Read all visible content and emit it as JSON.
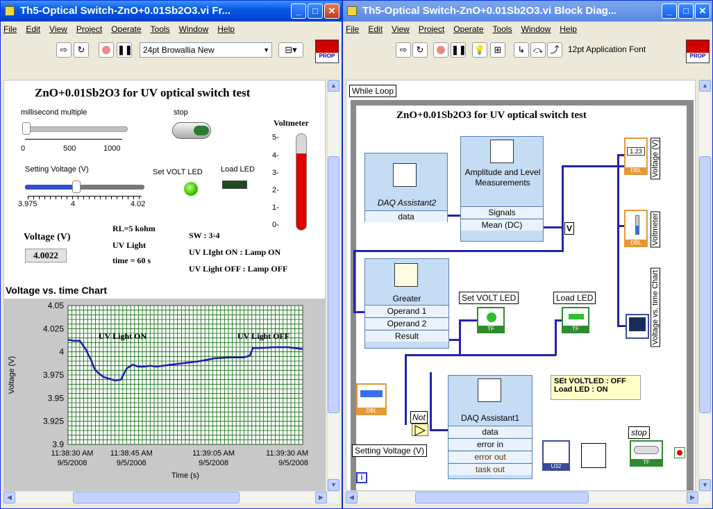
{
  "left_window": {
    "title": "Th5-Optical Switch-ZnO+0.01Sb2O3.vi Fr...",
    "menu": [
      "File",
      "Edit",
      "View",
      "Project",
      "Operate",
      "Tools",
      "Window",
      "Help"
    ],
    "font_selector": "24pt Browallia New",
    "panel_title": "ZnO+0.01Sb2O3 for UV optical switch test",
    "ms_multiple_label": "millisecond multiple",
    "ms_scale": [
      "0",
      "500",
      "1000"
    ],
    "stop_label": "stop",
    "voltmeter_label": "Voltmeter",
    "voltmeter_scale": [
      "5-",
      "4-",
      "3-",
      "2-",
      "1-",
      "0-"
    ],
    "voltmeter_level": 0.8,
    "setting_voltage_label": "Setting Voltage (V)",
    "setting_scale": [
      "3.975",
      "4",
      "4.02"
    ],
    "set_volt_led_label": "Set VOLT LED",
    "load_led_label": "Load LED",
    "voltage_label": "Voltage (V)",
    "voltage_value": "4.0022",
    "rl": "RL=5 kohm",
    "uv_light": "UV Light",
    "time": "time = 60 s",
    "sw": "SW : 3-4",
    "uv_on_lamp": "UV LIght ON : Lamp ON",
    "uv_off_lamp": "UV Light OFF : Lamp OFF",
    "chart_title": "Voltage vs. time Chart",
    "colors": {
      "title_blue": "#0a58e4",
      "plot_bg": "#ffffff",
      "grid": "#006400",
      "trace": "#1a1ab0",
      "thermo_red": "#e10000",
      "chart_frame": "#c8c8c8"
    }
  },
  "chart_data": {
    "type": "line",
    "title": "Voltage vs. time Chart",
    "xlabel": "Time (s)",
    "ylabel": "Voltage (V)",
    "ylim": [
      3.9,
      4.05
    ],
    "yticks": [
      "4.05",
      "4.025",
      "4",
      "3.975",
      "3.95",
      "3.925",
      "3.9"
    ],
    "xticks": [
      {
        "time": "11:38:30 AM",
        "date": "9/5/2008"
      },
      {
        "time": "11:38:45 AM",
        "date": "9/5/2008"
      },
      {
        "time": "11:39:05 AM",
        "date": "9/5/2008"
      },
      {
        "time": "11:39:30 AM",
        "date": "9/5/2008"
      }
    ],
    "annotations": [
      "UV Light ON",
      "UV Light OFF"
    ],
    "series": [
      {
        "x": [
          0,
          2,
          4,
          6,
          8,
          9,
          10,
          12,
          14,
          16,
          18,
          20,
          22,
          24,
          26,
          28,
          30,
          35,
          40,
          45,
          50,
          55,
          60,
          62,
          63,
          65,
          70,
          75,
          80
        ],
        "values": [
          4.013,
          4.012,
          4.012,
          4.003,
          3.99,
          3.982,
          3.978,
          3.973,
          3.971,
          3.969,
          3.97,
          3.982,
          3.986,
          3.984,
          3.984,
          3.985,
          3.984,
          3.986,
          3.988,
          3.99,
          3.993,
          3.994,
          3.994,
          3.996,
          4.004,
          4.004,
          4.005,
          4.005,
          4.003
        ]
      }
    ],
    "grid": true
  },
  "right_window": {
    "title": "Th5-Optical Switch-ZnO+0.01Sb2O3.vi Block Diag...",
    "menu": [
      "File",
      "Edit",
      "View",
      "Project",
      "Operate",
      "Tools",
      "Window",
      "Help"
    ],
    "font_selector": "12pt Application Font",
    "while_loop_label": "While Loop",
    "diagram_title": "ZnO+0.01Sb2O3 for UV optical switch test",
    "daq2_label": "DAQ Assistant2",
    "daq2_out": "data",
    "amp_title": "Amplitude and Level Measurements",
    "amp_signals": "Signals",
    "amp_mean": "Mean (DC)",
    "v_label": "V",
    "greater_title": "Greater",
    "operand1": "Operand 1",
    "operand2": "Operand 2",
    "result": "Result",
    "set_volt_led": "Set VOLT LED",
    "load_led": "Load LED",
    "voltage_term": "Voltage (V)",
    "voltmeter_term": "Voltmeter",
    "chart_term": "Voltage vs. time Chart",
    "dbl": "DBL",
    "tf": "TF",
    "not_label": "Not",
    "daq1_title": "DAQ Assistant1",
    "daq1_rows": [
      "data",
      "error in",
      "error out",
      "task out"
    ],
    "setting_voltage_term": "Setting Voltage (V)",
    "note_line1": "SEt VOLTLED : OFF",
    "note_line2": "Load LED      : ON",
    "stop_term": "stop",
    "u32": "U32",
    "iter": "i",
    "num_123": "1.23"
  }
}
